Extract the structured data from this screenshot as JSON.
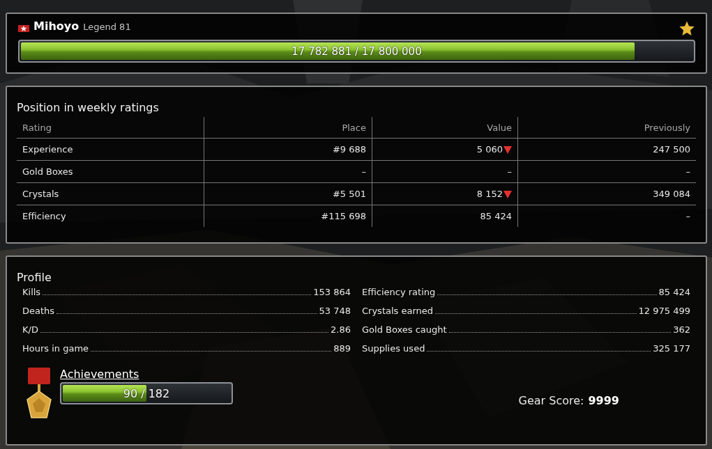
{
  "player": {
    "name": "Mihoyo",
    "rank": "Legend 81",
    "favorite": true,
    "experience": {
      "text": "17 782 881 / 17 800 000",
      "level": 0.91
    }
  },
  "weekly_ratings": {
    "title": "Position in weekly ratings",
    "columns": [
      "Rating",
      "Place",
      "Value",
      "Previously"
    ],
    "rows": [
      {
        "rating": "Experience",
        "place": "#9 688",
        "value": "5 060",
        "trend_down": true,
        "previously": "247 500"
      },
      {
        "rating": "Gold Boxes",
        "place": "–",
        "value": "–",
        "trend_down": false,
        "previously": "–"
      },
      {
        "rating": "Crystals",
        "place": "#5 501",
        "value": "8 152",
        "trend_down": true,
        "previously": "349 084"
      },
      {
        "rating": "Efficiency",
        "place": "#115 698",
        "value": "85 424",
        "trend_down": false,
        "previously": "–"
      }
    ]
  },
  "profile": {
    "title": "Profile",
    "left": [
      {
        "label": "Kills",
        "value": "153 864"
      },
      {
        "label": "Deaths",
        "value": "53 748"
      },
      {
        "label": "K/D",
        "value": "2.86"
      },
      {
        "label": "Hours in game",
        "value": "889"
      }
    ],
    "right": [
      {
        "label": "Efficiency rating",
        "value": "85 424"
      },
      {
        "label": "Crystals earned",
        "value": "12 975 499"
      },
      {
        "label": "Gold Boxes caught",
        "value": "362"
      },
      {
        "label": "Supplies used",
        "value": "325 177"
      }
    ],
    "achievements": {
      "link": "Achievements",
      "text": "90 / 182",
      "level": 0.49
    },
    "gear_score": {
      "label": "Gear Score:",
      "value": "9999"
    }
  }
}
